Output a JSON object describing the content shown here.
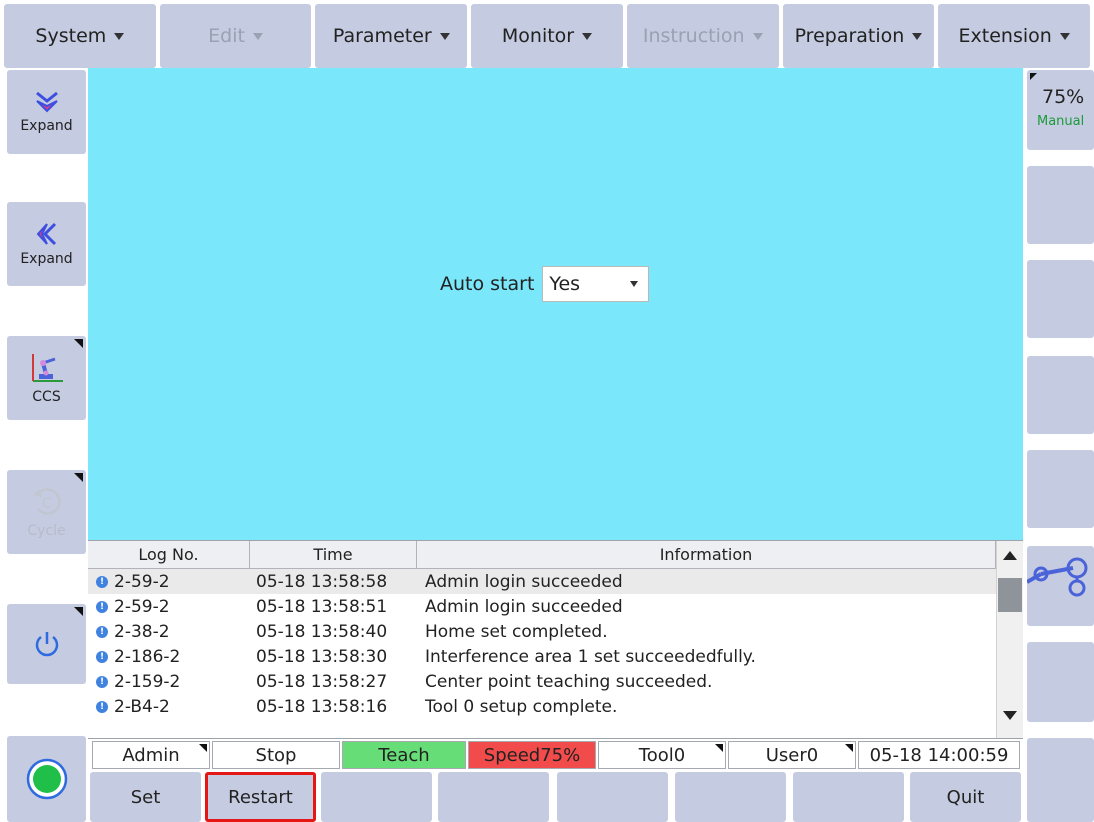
{
  "menu": {
    "items": [
      {
        "label": "System",
        "enabled": true
      },
      {
        "label": "Edit",
        "enabled": false
      },
      {
        "label": "Parameter",
        "enabled": true
      },
      {
        "label": "Monitor",
        "enabled": true
      },
      {
        "label": "Instruction",
        "enabled": false
      },
      {
        "label": "Preparation",
        "enabled": true
      },
      {
        "label": "Extension",
        "enabled": true
      }
    ]
  },
  "left": {
    "expand_down_label": "Expand",
    "expand_left_label": "Expand",
    "ccs_label": "CCS",
    "cycle_label": "Cycle",
    "cycle_letter": "C"
  },
  "right": {
    "speed": "75%",
    "mode": "Manual"
  },
  "content": {
    "autostart_label": "Auto start",
    "autostart_value": "Yes"
  },
  "log": {
    "headers": {
      "no": "Log No.",
      "time": "Time",
      "info": "Information"
    },
    "rows": [
      {
        "no": "2-59-2",
        "time": "05-18 13:58:58",
        "info": "Admin  login succeeded"
      },
      {
        "no": "2-59-2",
        "time": "05-18 13:58:51",
        "info": "Admin  login succeeded"
      },
      {
        "no": "2-38-2",
        "time": "05-18 13:58:40",
        "info": "Home set completed."
      },
      {
        "no": "2-186-2",
        "time": "05-18 13:58:30",
        "info": "Interference area 1 set succeededfully."
      },
      {
        "no": "2-159-2",
        "time": "05-18 13:58:27",
        "info": "Center point teaching succeeded."
      },
      {
        "no": "2-B4-2",
        "time": "05-18 13:58:16",
        "info": "Tool 0 setup complete."
      }
    ]
  },
  "status": {
    "user": "Admin",
    "run_state": "Stop",
    "mode": "Teach",
    "speed": "Speed75%",
    "tool": "Tool0",
    "user_frame": "User0",
    "datetime": "05-18 14:00:59"
  },
  "bottom": {
    "set_label": "Set",
    "restart_label": "Restart",
    "quit_label": "Quit"
  },
  "colors": {
    "content_bg": "#7ae8fa",
    "button_bg": "#c5cbe0",
    "teach_green": "#66dd76",
    "speed_red": "#f24b4b",
    "highlight_red": "#e41616",
    "manual_green": "#1b9a3b"
  }
}
